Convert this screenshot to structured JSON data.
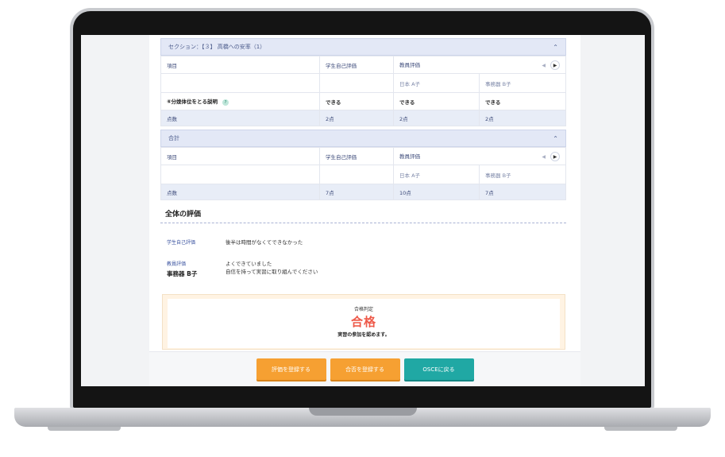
{
  "section1": {
    "title": "セクション：【３】 高橋への安率（1）",
    "headers": {
      "item": "項目",
      "self": "学生自己評価",
      "teacher": "教員評価"
    },
    "evaluators": [
      "日本 A子",
      "事務器 B子"
    ],
    "item_row": {
      "label": "⑥分娩体位をとる説明",
      "self": "できる",
      "eval1": "できる",
      "eval2": "できる"
    },
    "score_row": {
      "label": "点数",
      "self": "2点",
      "eval1": "2点",
      "eval2": "2点"
    }
  },
  "section2": {
    "title": "合計",
    "headers": {
      "item": "項目",
      "self": "学生自己評価",
      "teacher": "教員評価"
    },
    "evaluators": [
      "日本 A子",
      "事務器 B子"
    ],
    "score_row": {
      "label": "点数",
      "self": "7点",
      "eval1": "10点",
      "eval2": "7点"
    }
  },
  "overall": {
    "title": "全体の評価",
    "student_label": "学生自己評価",
    "student_comment": "後半は時間がなくてできなかった",
    "teacher_label": "教員評価",
    "teacher_name": "事務器 B子",
    "teacher_comment_1": "よくできていました",
    "teacher_comment_2": "自信を持って実習に取り組んでください"
  },
  "result": {
    "label": "合格判定",
    "value": "合格",
    "note": "実習の参加を認めます。"
  },
  "buttons": {
    "register_eval": "評価を登録する",
    "register_pass": "合否を登録する",
    "back": "OSCEに戻る"
  },
  "icons": {
    "collapse": "chevron-up-icon",
    "prev": "triangle-left-icon",
    "next": "triangle-right-icon",
    "help": "question-icon"
  },
  "colors": {
    "header_bg": "#e3e8f6",
    "accent_orange": "#f6a032",
    "accent_teal": "#20a8a4",
    "pass_red": "#ee5a4a"
  }
}
